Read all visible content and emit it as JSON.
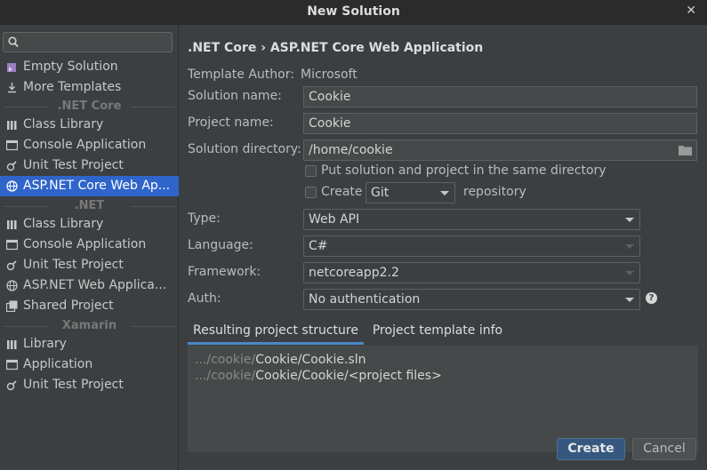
{
  "window": {
    "title": "New Solution"
  },
  "search": {
    "placeholder": "",
    "value": ""
  },
  "sidebar": {
    "top_items": [
      {
        "label": "Empty Solution",
        "icon": "solution-icon"
      },
      {
        "label": "More Templates",
        "icon": "download-icon"
      }
    ],
    "groups": [
      {
        "name": ".NET Core",
        "items": [
          {
            "label": "Class Library",
            "icon": "library-icon"
          },
          {
            "label": "Console Application",
            "icon": "console-icon"
          },
          {
            "label": "Unit Test Project",
            "icon": "test-icon"
          },
          {
            "label": "ASP.NET Core Web Ap...",
            "icon": "globe-icon",
            "selected": true
          }
        ]
      },
      {
        "name": ".NET",
        "items": [
          {
            "label": "Class Library",
            "icon": "library-icon"
          },
          {
            "label": "Console Application",
            "icon": "console-icon"
          },
          {
            "label": "Unit Test Project",
            "icon": "test-icon"
          },
          {
            "label": "ASP.NET Web Applica...",
            "icon": "globe-icon"
          },
          {
            "label": "Shared Project",
            "icon": "shared-icon"
          }
        ]
      },
      {
        "name": "Xamarin",
        "items": [
          {
            "label": "Library",
            "icon": "library-icon"
          },
          {
            "label": "Application",
            "icon": "application-icon"
          },
          {
            "label": "Unit Test Project",
            "icon": "test-icon"
          }
        ]
      }
    ]
  },
  "main": {
    "breadcrumb": ".NET Core › ASP.NET Core Web Application",
    "template_author_label": "Template Author:",
    "template_author_value": "Microsoft",
    "solution_name_label": "Solution name:",
    "solution_name_value": "Cookie",
    "project_name_label": "Project name:",
    "project_name_value": "Cookie",
    "solution_dir_label": "Solution directory:",
    "solution_dir_value": "/home/cookie",
    "same_dir_label": "Put solution and project in the same directory",
    "create_label": "Create",
    "vcs_value": "Git",
    "repository_label": "repository",
    "type_label": "Type:",
    "type_value": "Web API",
    "language_label": "Language:",
    "language_value": "C#",
    "framework_label": "Framework:",
    "framework_value": "netcoreapp2.2",
    "auth_label": "Auth:",
    "auth_value": "No authentication",
    "help_glyph": "?",
    "tabs": [
      {
        "label": "Resulting project structure",
        "active": true
      },
      {
        "label": "Project template info",
        "active": false
      }
    ],
    "structure_lines": [
      {
        "prefix": ".../cookie/",
        "path": "Cookie/Cookie.sln"
      },
      {
        "prefix": ".../cookie/",
        "path": "Cookie/Cookie/<project files>"
      }
    ]
  },
  "buttons": {
    "create": "Create",
    "cancel": "Cancel"
  },
  "colors": {
    "selection": "#2f65ca",
    "primary_button": "#365880",
    "tab_underline": "#4a88c7",
    "background": "#3c3f41"
  }
}
